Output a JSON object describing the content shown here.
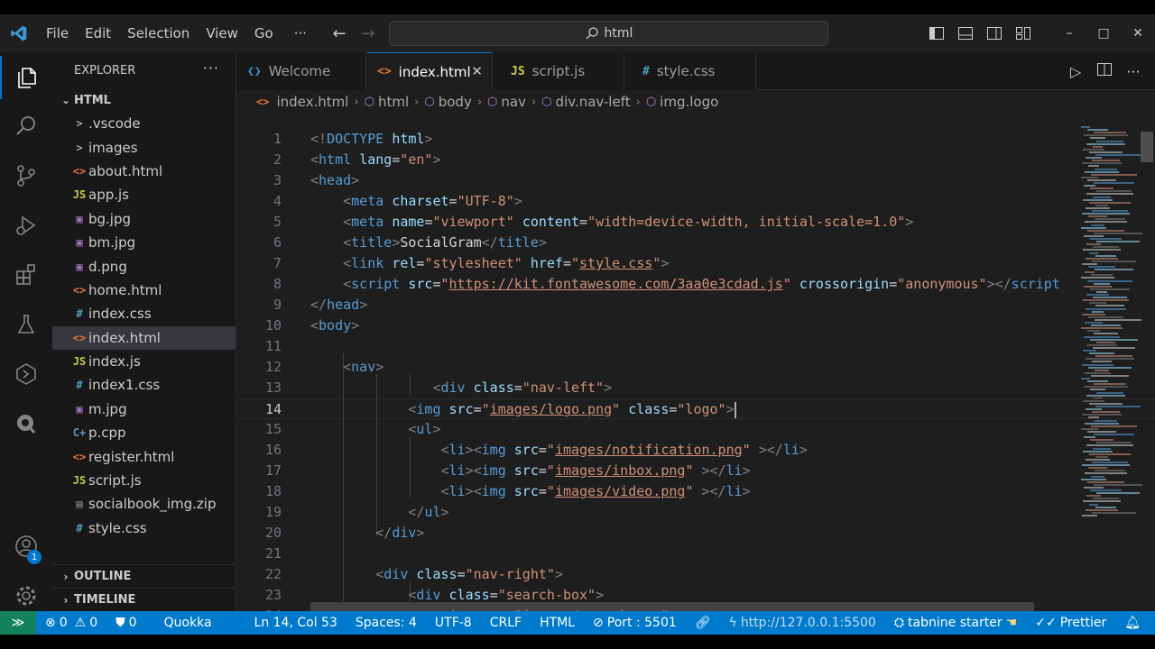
{
  "menu": [
    "File",
    "Edit",
    "Selection",
    "View",
    "Go"
  ],
  "menu_more": "···",
  "search": {
    "text": "html"
  },
  "window_controls": {
    "minimize": "–",
    "maximize": "□",
    "close": "✕"
  },
  "activity": {
    "items": [
      "files-icon",
      "search-icon",
      "source-control-icon",
      "run-debug-icon",
      "extensions-icon",
      "testing-icon",
      "remote-explorer-icon",
      "tabnine-icon"
    ],
    "accounts_badge": "1"
  },
  "sidebar": {
    "title": "EXPLORER",
    "more": "···",
    "folder": "HTML",
    "items": [
      {
        "name": ".vscode",
        "type": "folder",
        "icon": ">",
        "color": "#cccccc"
      },
      {
        "name": "images",
        "type": "folder",
        "icon": ">",
        "color": "#cccccc"
      },
      {
        "name": "about.html",
        "type": "html",
        "icon": "<>",
        "color": "#e37933"
      },
      {
        "name": "app.js",
        "type": "js",
        "icon": "JS",
        "color": "#cbcb41"
      },
      {
        "name": "bg.jpg",
        "type": "image",
        "icon": "▣",
        "color": "#a074c4"
      },
      {
        "name": "bm.jpg",
        "type": "image",
        "icon": "▣",
        "color": "#a074c4"
      },
      {
        "name": "d.png",
        "type": "image",
        "icon": "▣",
        "color": "#a074c4"
      },
      {
        "name": "home.html",
        "type": "html",
        "icon": "<>",
        "color": "#e37933"
      },
      {
        "name": "index.css",
        "type": "css",
        "icon": "#",
        "color": "#519aba"
      },
      {
        "name": "index.html",
        "type": "html",
        "icon": "<>",
        "color": "#e37933",
        "selected": true
      },
      {
        "name": "index.js",
        "type": "js",
        "icon": "JS",
        "color": "#cbcb41"
      },
      {
        "name": "index1.css",
        "type": "css",
        "icon": "#",
        "color": "#519aba"
      },
      {
        "name": "m.jpg",
        "type": "image",
        "icon": "▣",
        "color": "#a074c4"
      },
      {
        "name": "p.cpp",
        "type": "cpp",
        "icon": "C+",
        "color": "#519aba"
      },
      {
        "name": "register.html",
        "type": "html",
        "icon": "<>",
        "color": "#e37933"
      },
      {
        "name": "script.js",
        "type": "js",
        "icon": "JS",
        "color": "#cbcb41"
      },
      {
        "name": "socialbook_img.zip",
        "type": "zip",
        "icon": "▤",
        "color": "#8a8a8a"
      },
      {
        "name": "style.css",
        "type": "css",
        "icon": "#",
        "color": "#519aba"
      }
    ],
    "outline": "OUTLINE",
    "timeline": "TIMELINE"
  },
  "tabs": [
    {
      "label": "Welcome",
      "icon": "❮❯",
      "color": "#3c99d4",
      "active": false
    },
    {
      "label": "index.html",
      "icon": "<>",
      "color": "#e37933",
      "active": true
    },
    {
      "label": "script.js",
      "icon": "JS",
      "color": "#cbcb41",
      "active": false
    },
    {
      "label": "style.css",
      "icon": "#",
      "color": "#519aba",
      "active": false
    }
  ],
  "tab_close": "✕",
  "breadcrumb": [
    "index.html",
    "html",
    "body",
    "nav",
    "div.nav-left",
    "img.logo"
  ],
  "editor": {
    "current_line": 14,
    "lines": [
      [
        [
          "a",
          "<!"
        ],
        [
          "t",
          "DOCTYPE"
        ],
        [
          "x",
          " "
        ],
        [
          "r",
          "html"
        ],
        [
          "a",
          ">"
        ]
      ],
      [
        [
          "a",
          "<"
        ],
        [
          "t",
          "html"
        ],
        [
          "x",
          " "
        ],
        [
          "r",
          "lang"
        ],
        [
          "x",
          "="
        ],
        [
          "s",
          "\"en\""
        ],
        [
          "a",
          ">"
        ]
      ],
      [
        [
          "a",
          "<"
        ],
        [
          "t",
          "head"
        ],
        [
          "a",
          ">"
        ]
      ],
      [
        [
          "x",
          "    "
        ],
        [
          "a",
          "<"
        ],
        [
          "t",
          "meta"
        ],
        [
          "x",
          " "
        ],
        [
          "r",
          "charset"
        ],
        [
          "x",
          "="
        ],
        [
          "s",
          "\"UTF-8\""
        ],
        [
          "a",
          ">"
        ]
      ],
      [
        [
          "x",
          "    "
        ],
        [
          "a",
          "<"
        ],
        [
          "t",
          "meta"
        ],
        [
          "x",
          " "
        ],
        [
          "r",
          "name"
        ],
        [
          "x",
          "="
        ],
        [
          "s",
          "\"viewport\""
        ],
        [
          "x",
          " "
        ],
        [
          "r",
          "content"
        ],
        [
          "x",
          "="
        ],
        [
          "s",
          "\"width=device-width, initial-scale=1.0\""
        ],
        [
          "a",
          ">"
        ]
      ],
      [
        [
          "x",
          "    "
        ],
        [
          "a",
          "<"
        ],
        [
          "t",
          "title"
        ],
        [
          "a",
          ">"
        ],
        [
          "x",
          "SocialGram"
        ],
        [
          "a",
          "</"
        ],
        [
          "t",
          "title"
        ],
        [
          "a",
          ">"
        ]
      ],
      [
        [
          "x",
          "    "
        ],
        [
          "a",
          "<"
        ],
        [
          "t",
          "link"
        ],
        [
          "x",
          " "
        ],
        [
          "r",
          "rel"
        ],
        [
          "x",
          "="
        ],
        [
          "s",
          "\"stylesheet\""
        ],
        [
          "x",
          " "
        ],
        [
          "r",
          "href"
        ],
        [
          "x",
          "="
        ],
        [
          "s",
          "\""
        ],
        [
          "u",
          "style.css"
        ],
        [
          "s",
          "\""
        ],
        [
          "a",
          ">"
        ]
      ],
      [
        [
          "x",
          "    "
        ],
        [
          "a",
          "<"
        ],
        [
          "t",
          "script"
        ],
        [
          "x",
          " "
        ],
        [
          "r",
          "src"
        ],
        [
          "x",
          "="
        ],
        [
          "s",
          "\""
        ],
        [
          "u",
          "https://kit.fontawesome.com/3aa0e3cdad.js"
        ],
        [
          "s",
          "\""
        ],
        [
          "x",
          " "
        ],
        [
          "r",
          "crossorigin"
        ],
        [
          "x",
          "="
        ],
        [
          "s",
          "\"anonymous\""
        ],
        [
          "a",
          "></"
        ],
        [
          "t",
          "script"
        ]
      ],
      [
        [
          "a",
          "</"
        ],
        [
          "t",
          "head"
        ],
        [
          "a",
          ">"
        ]
      ],
      [
        [
          "a",
          "<"
        ],
        [
          "t",
          "body"
        ],
        [
          "a",
          ">"
        ]
      ],
      [],
      [
        [
          "x",
          "    "
        ],
        [
          "a",
          "<"
        ],
        [
          "t",
          "nav"
        ],
        [
          "a",
          ">"
        ]
      ],
      [
        [
          "x",
          "               "
        ],
        [
          "a",
          "<"
        ],
        [
          "t",
          "div"
        ],
        [
          "x",
          " "
        ],
        [
          "r",
          "class"
        ],
        [
          "x",
          "="
        ],
        [
          "s",
          "\"nav-left\""
        ],
        [
          "a",
          ">"
        ]
      ],
      [
        [
          "x",
          "            "
        ],
        [
          "a",
          "<"
        ],
        [
          "t",
          "img"
        ],
        [
          "x",
          " "
        ],
        [
          "r",
          "src"
        ],
        [
          "x",
          "="
        ],
        [
          "s",
          "\""
        ],
        [
          "u",
          "images/logo.png"
        ],
        [
          "s",
          "\""
        ],
        [
          "x",
          " "
        ],
        [
          "r",
          "class"
        ],
        [
          "x",
          "="
        ],
        [
          "s",
          "\"logo\""
        ],
        [
          "a",
          ">"
        ],
        [
          "c",
          ""
        ]
      ],
      [
        [
          "x",
          "            "
        ],
        [
          "a",
          "<"
        ],
        [
          "t",
          "ul"
        ],
        [
          "a",
          ">"
        ]
      ],
      [
        [
          "x",
          "                "
        ],
        [
          "a",
          "<"
        ],
        [
          "t",
          "li"
        ],
        [
          "a",
          "><"
        ],
        [
          "t",
          "img"
        ],
        [
          "x",
          " "
        ],
        [
          "r",
          "src"
        ],
        [
          "x",
          "="
        ],
        [
          "s",
          "\""
        ],
        [
          "u",
          "images/notification.png"
        ],
        [
          "s",
          "\""
        ],
        [
          "x",
          " "
        ],
        [
          "a",
          "></"
        ],
        [
          "t",
          "li"
        ],
        [
          "a",
          ">"
        ]
      ],
      [
        [
          "x",
          "                "
        ],
        [
          "a",
          "<"
        ],
        [
          "t",
          "li"
        ],
        [
          "a",
          "><"
        ],
        [
          "t",
          "img"
        ],
        [
          "x",
          " "
        ],
        [
          "r",
          "src"
        ],
        [
          "x",
          "="
        ],
        [
          "s",
          "\""
        ],
        [
          "u",
          "images/inbox.png"
        ],
        [
          "s",
          "\""
        ],
        [
          "x",
          " "
        ],
        [
          "a",
          "></"
        ],
        [
          "t",
          "li"
        ],
        [
          "a",
          ">"
        ]
      ],
      [
        [
          "x",
          "                "
        ],
        [
          "a",
          "<"
        ],
        [
          "t",
          "li"
        ],
        [
          "a",
          "><"
        ],
        [
          "t",
          "img"
        ],
        [
          "x",
          " "
        ],
        [
          "r",
          "src"
        ],
        [
          "x",
          "="
        ],
        [
          "s",
          "\""
        ],
        [
          "u",
          "images/video.png"
        ],
        [
          "s",
          "\""
        ],
        [
          "x",
          " "
        ],
        [
          "a",
          "></"
        ],
        [
          "t",
          "li"
        ],
        [
          "a",
          ">"
        ]
      ],
      [
        [
          "x",
          "            "
        ],
        [
          "a",
          "</"
        ],
        [
          "t",
          "ul"
        ],
        [
          "a",
          ">"
        ]
      ],
      [
        [
          "x",
          "        "
        ],
        [
          "a",
          "</"
        ],
        [
          "t",
          "div"
        ],
        [
          "a",
          ">"
        ]
      ],
      [],
      [
        [
          "x",
          "        "
        ],
        [
          "a",
          "<"
        ],
        [
          "t",
          "div"
        ],
        [
          "x",
          " "
        ],
        [
          "r",
          "class"
        ],
        [
          "x",
          "="
        ],
        [
          "s",
          "\"nav-right\""
        ],
        [
          "a",
          ">"
        ]
      ],
      [
        [
          "x",
          "            "
        ],
        [
          "a",
          "<"
        ],
        [
          "t",
          "div"
        ],
        [
          "x",
          " "
        ],
        [
          "r",
          "class"
        ],
        [
          "x",
          "="
        ],
        [
          "s",
          "\"search-box\""
        ],
        [
          "a",
          ">"
        ]
      ],
      [
        [
          "x",
          "                "
        ],
        [
          "a",
          "<"
        ],
        [
          "t",
          "img"
        ],
        [
          "x",
          " "
        ],
        [
          "r",
          "src"
        ],
        [
          "x",
          "="
        ],
        [
          "s",
          "\""
        ],
        [
          "u",
          "images/search.png"
        ],
        [
          "s",
          "\""
        ],
        [
          "x",
          " "
        ],
        [
          "a",
          ">"
        ]
      ]
    ]
  },
  "statusbar": {
    "remote": "≫",
    "errors": "0",
    "warnings": "0",
    "ports": "0",
    "quokka": "Quokka",
    "position": "Ln 14, Col 53",
    "spaces": "Spaces: 4",
    "encoding": "UTF-8",
    "eol": "CRLF",
    "language": "HTML",
    "port": "Port : 5501",
    "url": "http://127.0.0.1:5500",
    "tabnine": "tabnine starter",
    "prettier": "Prettier"
  },
  "colors": {
    "accent": "#0078d4",
    "statusbar": "#007acc",
    "remote": "#16825d"
  }
}
